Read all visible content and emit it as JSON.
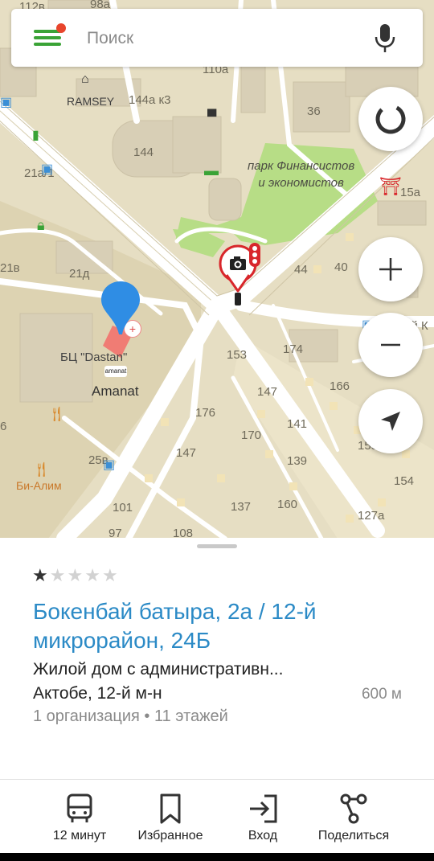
{
  "search": {
    "placeholder": "Поиск"
  },
  "map": {
    "house_numbers": [
      "112в",
      "98а",
      "110а",
      "144а к3",
      "36",
      "144",
      "21а/1",
      "15а",
      "21в",
      "21д",
      "40",
      "44",
      "Зой К",
      "174",
      "153",
      "147",
      "166",
      "176",
      "170",
      "141",
      "147",
      "139",
      "155",
      "25в",
      "154",
      "101",
      "137",
      "160",
      "127а",
      "97",
      "108",
      "6"
    ],
    "pois": {
      "ramsey": "RAMSEY",
      "bc_dastan": "БЦ \"Dastan\"",
      "amanat": "Amanat",
      "amanat_logo": "amanat",
      "bi_alim": "Би-Алим",
      "park_line1": "парк Финансистов",
      "park_line2": "и экономистов"
    }
  },
  "card": {
    "rating": 1,
    "rating_max": 5,
    "title": "Бокенбай батыра, 2а / 12-й микрорайон, 24Б",
    "description": "Жилой дом с административн...",
    "address": "Актобе, 12-й м-н",
    "distance": "600 м",
    "meta": "1 организация • 11 этажей"
  },
  "bottom_bar": {
    "route": "12 минут",
    "favorites": "Избранное",
    "entrance": "Вход",
    "share": "Поделиться"
  },
  "colors": {
    "accent_green": "#3aa336",
    "link_blue": "#2b8ac6",
    "pin_blue": "#2f8de4",
    "camera_red": "#d8262b"
  }
}
